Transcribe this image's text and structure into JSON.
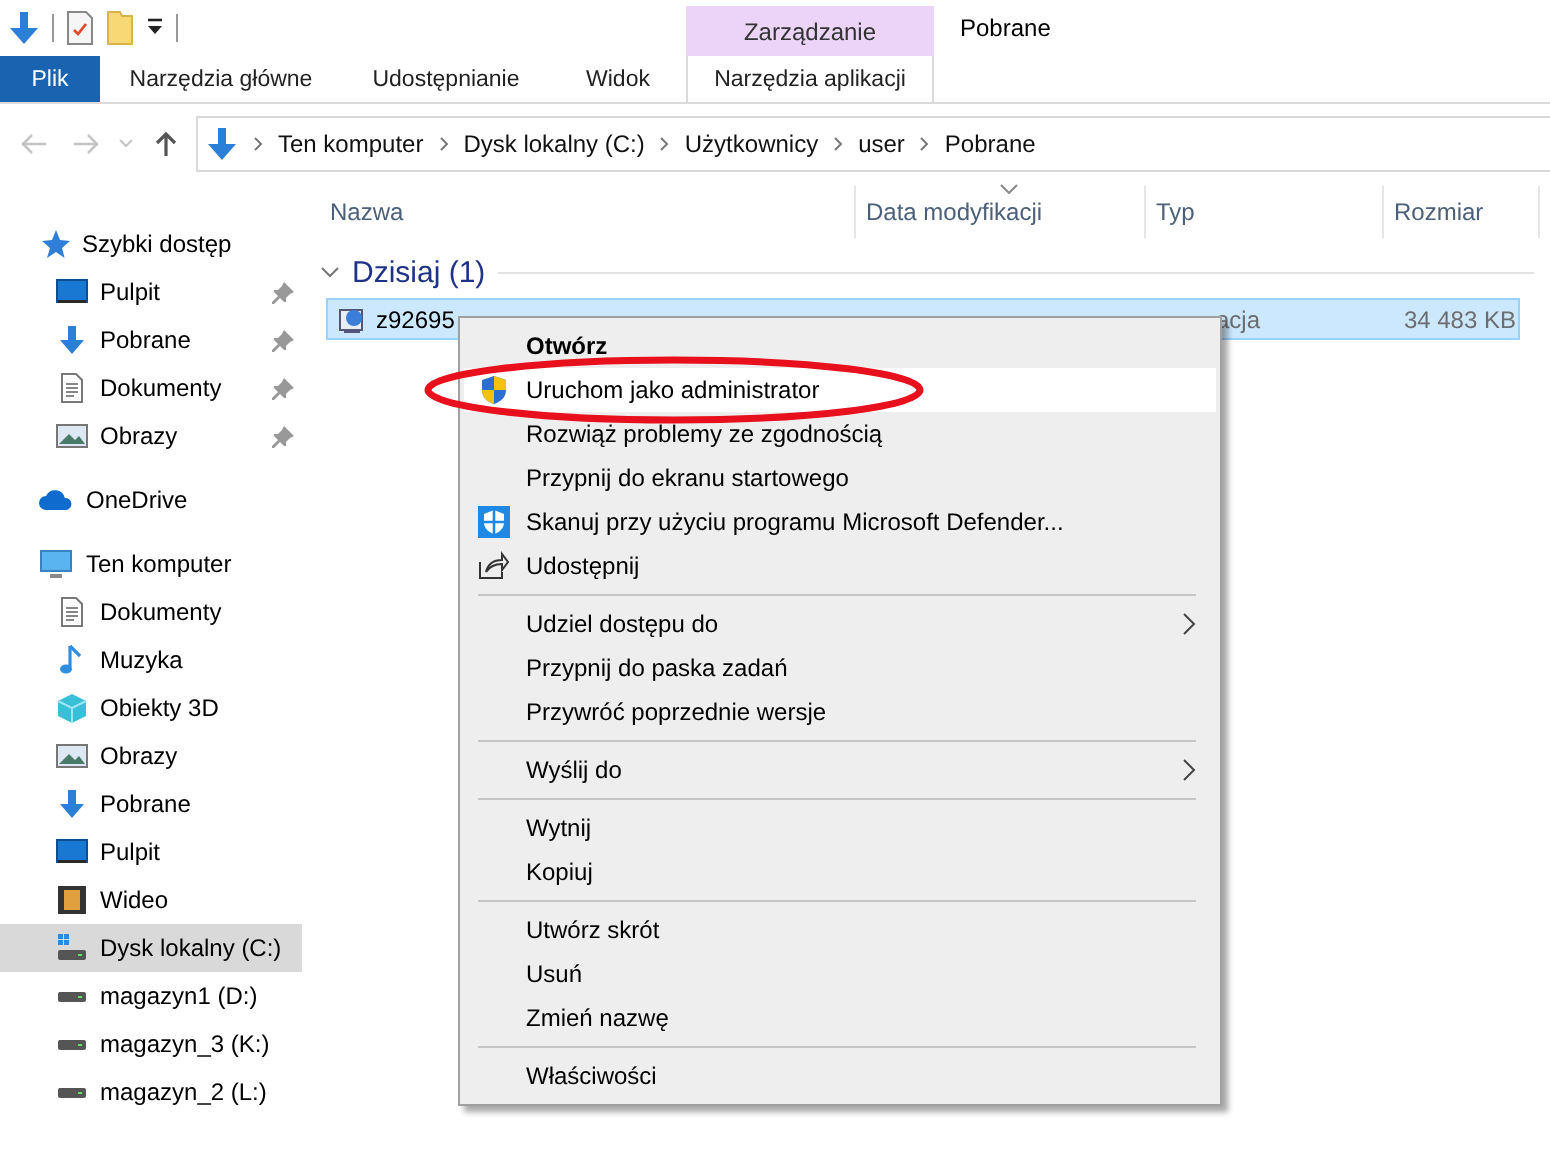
{
  "window": {
    "title": "Pobrane"
  },
  "ribbon": {
    "contextual_header": "Zarządzanie",
    "tabs": [
      {
        "label": "Plik",
        "kind": "file",
        "selected": false
      },
      {
        "label": "Narzędzia główne",
        "kind": "tab",
        "selected": false
      },
      {
        "label": "Udostępnianie",
        "kind": "tab",
        "selected": false
      },
      {
        "label": "Widok",
        "kind": "tab",
        "selected": false
      },
      {
        "label": "Narzędzia aplikacji",
        "kind": "contextual",
        "selected": false
      }
    ]
  },
  "address_bar": {
    "back_disabled": true,
    "forward_disabled": true,
    "path": [
      "Ten komputer",
      "Dysk lokalny (C:)",
      "Użytkownicy",
      "user",
      "Pobrane"
    ]
  },
  "sidebar": {
    "sections": [
      {
        "label": "Szybki dostęp",
        "kind": "star",
        "selected": false,
        "children": [
          {
            "label": "Pulpit",
            "kind": "desktop",
            "pinned": true,
            "selected": false
          },
          {
            "label": "Pobrane",
            "kind": "download",
            "pinned": true,
            "selected": false
          },
          {
            "label": "Dokumenty",
            "kind": "document",
            "pinned": true,
            "selected": false
          },
          {
            "label": "Obrazy",
            "kind": "picture",
            "pinned": true,
            "selected": false
          }
        ]
      },
      {
        "label": "OneDrive",
        "kind": "cloud",
        "selected": false
      },
      {
        "label": "Ten komputer",
        "kind": "computer",
        "selected": false,
        "children": [
          {
            "label": "Dokumenty",
            "kind": "document",
            "pinned": false,
            "selected": false
          },
          {
            "label": "Muzyka",
            "kind": "music",
            "pinned": false,
            "selected": false
          },
          {
            "label": "Obiekty 3D",
            "kind": "cube",
            "pinned": false,
            "selected": false
          },
          {
            "label": "Obrazy",
            "kind": "picture",
            "pinned": false,
            "selected": false
          },
          {
            "label": "Pobrane",
            "kind": "download",
            "pinned": false,
            "selected": false
          },
          {
            "label": "Pulpit",
            "kind": "desktop",
            "pinned": false,
            "selected": false
          },
          {
            "label": "Wideo",
            "kind": "video",
            "pinned": false,
            "selected": false
          },
          {
            "label": "Dysk lokalny (C:)",
            "kind": "system-drive",
            "pinned": false,
            "selected": true
          },
          {
            "label": "magazyn1 (D:)",
            "kind": "drive",
            "pinned": false,
            "selected": false
          },
          {
            "label": "magazyn_3 (K:)",
            "kind": "drive",
            "pinned": false,
            "selected": false
          },
          {
            "label": "magazyn_2 (L:)",
            "kind": "drive",
            "pinned": false,
            "selected": false
          }
        ]
      }
    ]
  },
  "table": {
    "columns": [
      {
        "label": "Nazwa",
        "sorted": false
      },
      {
        "label": "Data modyfikacji",
        "sorted": true
      },
      {
        "label": "Typ",
        "sorted": false
      },
      {
        "label": "Rozmiar",
        "sorted": false
      }
    ],
    "groups": [
      {
        "label": "Dzisiaj (1)",
        "expanded": true,
        "rows": [
          {
            "name": "z92695",
            "type": "acja",
            "size": "34 483 KB",
            "selected": true
          }
        ]
      }
    ]
  },
  "context_menu": {
    "items": [
      {
        "kind": "plain",
        "label": "Otwórz",
        "default": true,
        "highlighted": false,
        "submenu": false,
        "circled": false
      },
      {
        "kind": "shield",
        "label": "Uruchom jako administrator",
        "default": false,
        "highlighted": true,
        "submenu": false,
        "circled": true
      },
      {
        "kind": "plain",
        "label": "Rozwiąż problemy ze zgodnością",
        "default": false,
        "highlighted": false,
        "submenu": false,
        "circled": false
      },
      {
        "kind": "plain",
        "label": "Przypnij do ekranu startowego",
        "default": false,
        "highlighted": false,
        "submenu": false,
        "circled": false
      },
      {
        "kind": "defender",
        "label": "Skanuj przy użyciu programu Microsoft Defender...",
        "default": false,
        "highlighted": false,
        "submenu": false,
        "circled": false
      },
      {
        "kind": "share",
        "label": "Udostępnij",
        "default": false,
        "highlighted": false,
        "submenu": false,
        "circled": false
      },
      {
        "kind": "separator"
      },
      {
        "kind": "plain",
        "label": "Udziel dostępu do",
        "default": false,
        "highlighted": false,
        "submenu": true,
        "circled": false
      },
      {
        "kind": "plain",
        "label": "Przypnij do paska zadań",
        "default": false,
        "highlighted": false,
        "submenu": false,
        "circled": false
      },
      {
        "kind": "plain",
        "label": "Przywróć poprzednie wersje",
        "default": false,
        "highlighted": false,
        "submenu": false,
        "circled": false
      },
      {
        "kind": "separator"
      },
      {
        "kind": "plain",
        "label": "Wyślij do",
        "default": false,
        "highlighted": false,
        "submenu": true,
        "circled": false
      },
      {
        "kind": "separator"
      },
      {
        "kind": "plain",
        "label": "Wytnij",
        "default": false,
        "highlighted": false,
        "submenu": false,
        "circled": false
      },
      {
        "kind": "plain",
        "label": "Kopiuj",
        "default": false,
        "highlighted": false,
        "submenu": false,
        "circled": false
      },
      {
        "kind": "separator"
      },
      {
        "kind": "plain",
        "label": "Utwórz skrót",
        "default": false,
        "highlighted": false,
        "submenu": false,
        "circled": false
      },
      {
        "kind": "plain",
        "label": "Usuń",
        "default": false,
        "highlighted": false,
        "submenu": false,
        "circled": false
      },
      {
        "kind": "plain",
        "label": "Zmień nazwę",
        "default": false,
        "highlighted": false,
        "submenu": false,
        "circled": false
      },
      {
        "kind": "separator"
      },
      {
        "kind": "plain",
        "label": "Właściwości",
        "default": false,
        "highlighted": false,
        "submenu": false,
        "circled": false
      }
    ]
  }
}
